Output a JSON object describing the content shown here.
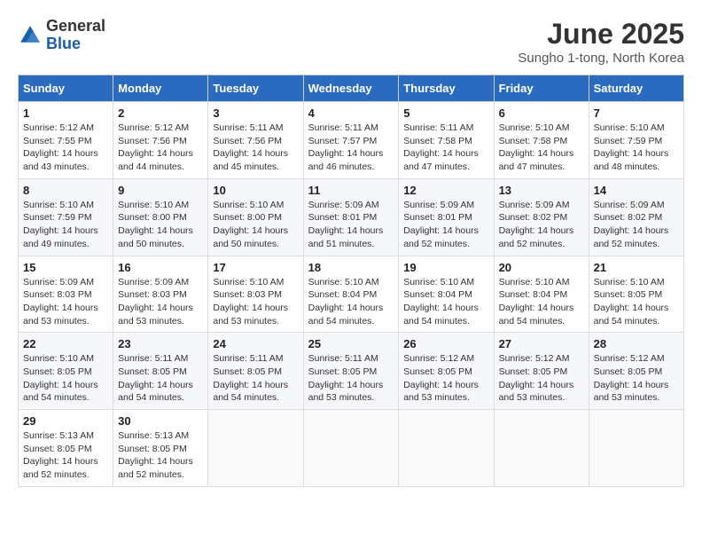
{
  "header": {
    "logo_line1": "General",
    "logo_line2": "Blue",
    "month": "June 2025",
    "location": "Sungho 1-tong, North Korea"
  },
  "columns": [
    "Sunday",
    "Monday",
    "Tuesday",
    "Wednesday",
    "Thursday",
    "Friday",
    "Saturday"
  ],
  "weeks": [
    [
      {
        "day": "1",
        "sunrise": "5:12 AM",
        "sunset": "7:55 PM",
        "daylight": "14 hours and 43 minutes."
      },
      {
        "day": "2",
        "sunrise": "5:12 AM",
        "sunset": "7:56 PM",
        "daylight": "14 hours and 44 minutes."
      },
      {
        "day": "3",
        "sunrise": "5:11 AM",
        "sunset": "7:56 PM",
        "daylight": "14 hours and 45 minutes."
      },
      {
        "day": "4",
        "sunrise": "5:11 AM",
        "sunset": "7:57 PM",
        "daylight": "14 hours and 46 minutes."
      },
      {
        "day": "5",
        "sunrise": "5:11 AM",
        "sunset": "7:58 PM",
        "daylight": "14 hours and 47 minutes."
      },
      {
        "day": "6",
        "sunrise": "5:10 AM",
        "sunset": "7:58 PM",
        "daylight": "14 hours and 47 minutes."
      },
      {
        "day": "7",
        "sunrise": "5:10 AM",
        "sunset": "7:59 PM",
        "daylight": "14 hours and 48 minutes."
      }
    ],
    [
      {
        "day": "8",
        "sunrise": "5:10 AM",
        "sunset": "7:59 PM",
        "daylight": "14 hours and 49 minutes."
      },
      {
        "day": "9",
        "sunrise": "5:10 AM",
        "sunset": "8:00 PM",
        "daylight": "14 hours and 50 minutes."
      },
      {
        "day": "10",
        "sunrise": "5:10 AM",
        "sunset": "8:00 PM",
        "daylight": "14 hours and 50 minutes."
      },
      {
        "day": "11",
        "sunrise": "5:09 AM",
        "sunset": "8:01 PM",
        "daylight": "14 hours and 51 minutes."
      },
      {
        "day": "12",
        "sunrise": "5:09 AM",
        "sunset": "8:01 PM",
        "daylight": "14 hours and 52 minutes."
      },
      {
        "day": "13",
        "sunrise": "5:09 AM",
        "sunset": "8:02 PM",
        "daylight": "14 hours and 52 minutes."
      },
      {
        "day": "14",
        "sunrise": "5:09 AM",
        "sunset": "8:02 PM",
        "daylight": "14 hours and 52 minutes."
      }
    ],
    [
      {
        "day": "15",
        "sunrise": "5:09 AM",
        "sunset": "8:03 PM",
        "daylight": "14 hours and 53 minutes."
      },
      {
        "day": "16",
        "sunrise": "5:09 AM",
        "sunset": "8:03 PM",
        "daylight": "14 hours and 53 minutes."
      },
      {
        "day": "17",
        "sunrise": "5:10 AM",
        "sunset": "8:03 PM",
        "daylight": "14 hours and 53 minutes."
      },
      {
        "day": "18",
        "sunrise": "5:10 AM",
        "sunset": "8:04 PM",
        "daylight": "14 hours and 54 minutes."
      },
      {
        "day": "19",
        "sunrise": "5:10 AM",
        "sunset": "8:04 PM",
        "daylight": "14 hours and 54 minutes."
      },
      {
        "day": "20",
        "sunrise": "5:10 AM",
        "sunset": "8:04 PM",
        "daylight": "14 hours and 54 minutes."
      },
      {
        "day": "21",
        "sunrise": "5:10 AM",
        "sunset": "8:05 PM",
        "daylight": "14 hours and 54 minutes."
      }
    ],
    [
      {
        "day": "22",
        "sunrise": "5:10 AM",
        "sunset": "8:05 PM",
        "daylight": "14 hours and 54 minutes."
      },
      {
        "day": "23",
        "sunrise": "5:11 AM",
        "sunset": "8:05 PM",
        "daylight": "14 hours and 54 minutes."
      },
      {
        "day": "24",
        "sunrise": "5:11 AM",
        "sunset": "8:05 PM",
        "daylight": "14 hours and 54 minutes."
      },
      {
        "day": "25",
        "sunrise": "5:11 AM",
        "sunset": "8:05 PM",
        "daylight": "14 hours and 53 minutes."
      },
      {
        "day": "26",
        "sunrise": "5:12 AM",
        "sunset": "8:05 PM",
        "daylight": "14 hours and 53 minutes."
      },
      {
        "day": "27",
        "sunrise": "5:12 AM",
        "sunset": "8:05 PM",
        "daylight": "14 hours and 53 minutes."
      },
      {
        "day": "28",
        "sunrise": "5:12 AM",
        "sunset": "8:05 PM",
        "daylight": "14 hours and 53 minutes."
      }
    ],
    [
      {
        "day": "29",
        "sunrise": "5:13 AM",
        "sunset": "8:05 PM",
        "daylight": "14 hours and 52 minutes."
      },
      {
        "day": "30",
        "sunrise": "5:13 AM",
        "sunset": "8:05 PM",
        "daylight": "14 hours and 52 minutes."
      },
      null,
      null,
      null,
      null,
      null
    ]
  ]
}
